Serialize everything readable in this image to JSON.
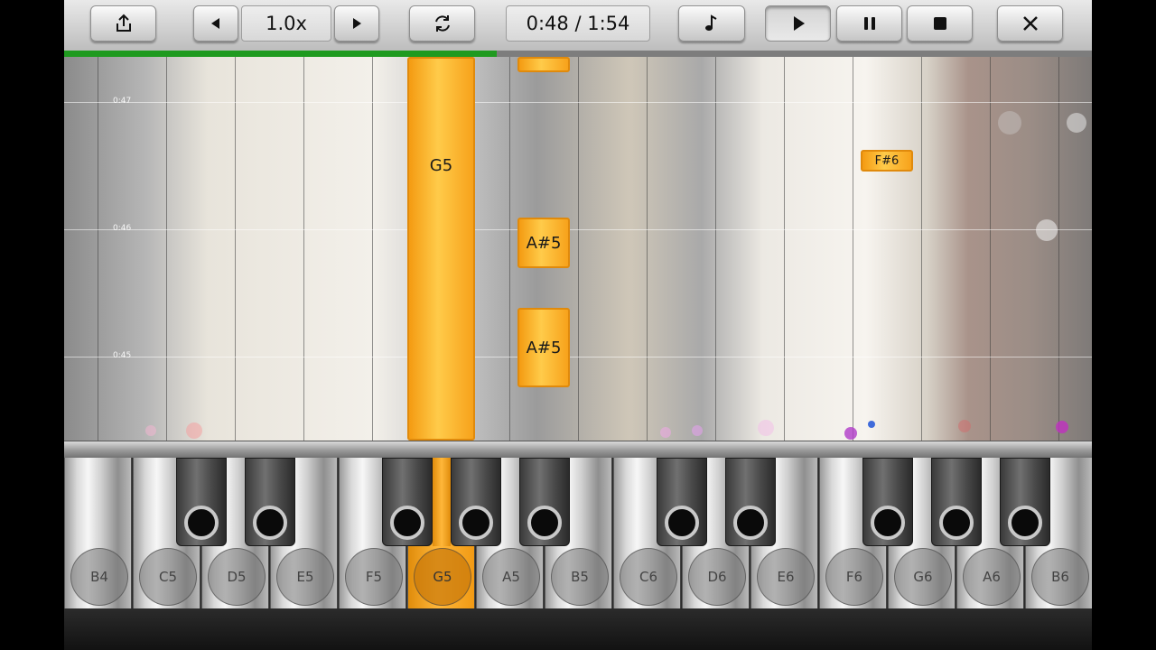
{
  "toolbar": {
    "speed_label": "1.0x",
    "time_display": "0:48 / 1:54",
    "icons": [
      "share-icon",
      "speed-down-icon",
      "speed-up-icon",
      "loop-icon",
      "music-note-icon",
      "play-icon",
      "pause-icon",
      "stop-icon",
      "close-icon"
    ]
  },
  "progress": {
    "fraction": 0.421
  },
  "roll": {
    "time_marks": [
      "0:47",
      "0:46",
      "0:45"
    ],
    "notes": [
      {
        "label": "G5"
      },
      {
        "label": "A#5"
      },
      {
        "label": "A#5"
      },
      {
        "label": "F#6"
      },
      {
        "label": ""
      }
    ]
  },
  "keyboard": {
    "white_keys": [
      "B4",
      "C5",
      "D5",
      "E5",
      "F5",
      "G5",
      "A5",
      "B5",
      "C6",
      "D6",
      "E6",
      "F6",
      "G6",
      "A6",
      "B6"
    ],
    "active_key": "G5"
  },
  "colors": {
    "note": "#ffb73a",
    "progress": "#1f9a1f"
  }
}
